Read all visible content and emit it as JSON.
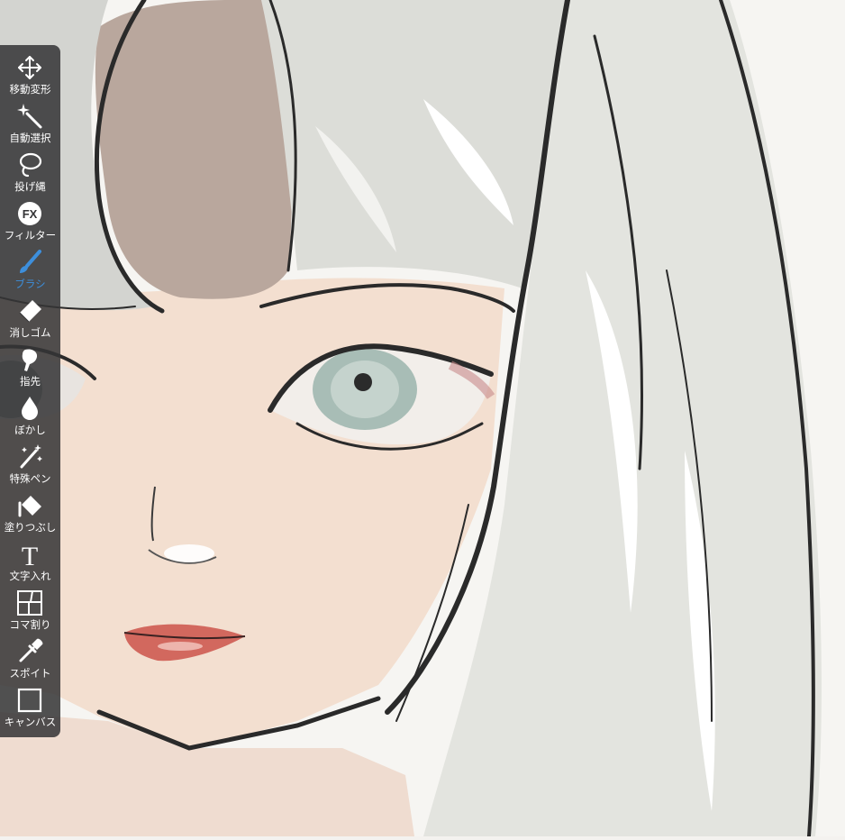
{
  "toolbar": {
    "accent_color": "#3d8fdc",
    "active_tool": "brush",
    "tools": [
      {
        "id": "move-transform",
        "label": "移動変形",
        "icon": "move-arrows-icon"
      },
      {
        "id": "auto-select",
        "label": "自動選択",
        "icon": "magic-wand-icon"
      },
      {
        "id": "lasso",
        "label": "投げ縄",
        "icon": "lasso-icon"
      },
      {
        "id": "filter",
        "label": "フィルター",
        "icon": "fx-icon"
      },
      {
        "id": "brush",
        "label": "ブラシ",
        "icon": "brush-icon"
      },
      {
        "id": "eraser",
        "label": "消しゴム",
        "icon": "eraser-icon"
      },
      {
        "id": "smudge",
        "label": "指先",
        "icon": "finger-smudge-icon"
      },
      {
        "id": "blur",
        "label": "ぼかし",
        "icon": "drop-icon"
      },
      {
        "id": "special-pen",
        "label": "特殊ペン",
        "icon": "sparkle-pen-icon"
      },
      {
        "id": "fill",
        "label": "塗りつぶし",
        "icon": "paint-bucket-icon"
      },
      {
        "id": "text",
        "label": "文字入れ",
        "icon": "text-t-icon"
      },
      {
        "id": "frame-divide",
        "label": "コマ割り",
        "icon": "panels-icon"
      },
      {
        "id": "eyedropper",
        "label": "スポイト",
        "icon": "eyedropper-icon"
      },
      {
        "id": "canvas",
        "label": "キャンバス",
        "icon": "canvas-square-icon"
      }
    ]
  }
}
